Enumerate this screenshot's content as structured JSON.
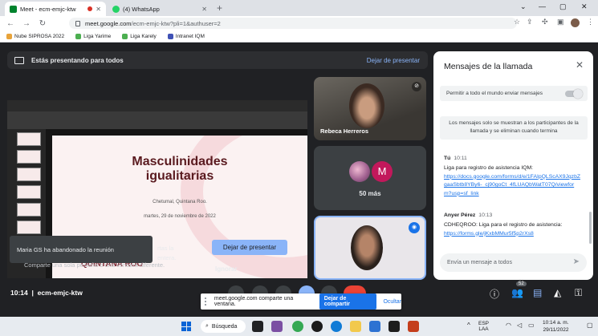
{
  "browser": {
    "tabs": [
      {
        "title": "Meet - ecm-emjc-ktw",
        "active": true
      },
      {
        "title": "(4) WhatsApp",
        "active": false
      }
    ],
    "url_host": "meet.google.com",
    "url_path": "/ecm-emjc-ktw?pli=1&authuser=2",
    "bookmarks": [
      "Nube SIPROSA 2022",
      "Liga Yarime",
      "Liga Karely",
      "Intranet IQM"
    ]
  },
  "meet": {
    "presenting_text": "Estás presentando para todos",
    "stop_presenting_link": "Dejar de presentar",
    "toast": "Maria GS ha abandonado la reunión",
    "warning_line1": "rtas la",
    "warning_line2": "entera.",
    "warning_line3": "Comparte una sola pestaña o una ventana diferente.",
    "stop_presenting_button": "Dejar de presentar",
    "ignore_button": "Ignorar",
    "slide": {
      "title_line1": "Masculinidades",
      "title_line2": "igualitarias",
      "place": "Chetumal, Quintana Roo.",
      "date": "martes, 29 de noviembre de 2022",
      "logo": "QUINTANA ROO"
    },
    "participants": {
      "tile1_name": "Rebeca Herreros",
      "more_count": "50 más",
      "avatar_letter": "M"
    },
    "meeting_time": "10:14",
    "meeting_code": "ecm-emjc-ktw",
    "participants_badge": "52"
  },
  "chat": {
    "title": "Mensajes de la llamada",
    "permission_label": "Permitir a todo el mundo enviar mensajes",
    "notice": "Los mensajes solo se muestran a los participantes de la llamada y se eliminan cuando termina",
    "messages": [
      {
        "sender": "Tú",
        "time": "10:11",
        "text": "Liga para registro de asistencia IQM:",
        "link": "https://docs.google.com/forms/d/e/1FAIpQLScAX9JqzbZgaaSbtb8YBy6-_cj90goCt_4fLUAQbWatT07Q/viewform?usp=sf_link"
      },
      {
        "sender": "Anyer Pérez",
        "time": "10:13",
        "text": "CDHEQROO: Liga para el registro de asistencia:",
        "link": "https://forms.gle/jKxbMMur5f5p2rXs8"
      }
    ],
    "input_placeholder": "Envía un mensaje a todos"
  },
  "sharebar": {
    "message": "meet.google.com comparte una ventana.",
    "stop_button": "Dejar de compartir",
    "hide_button": "Ocultar"
  },
  "taskbar": {
    "search_label": "Búsqueda",
    "lang_line1": "ESP",
    "lang_line2": "LAA",
    "time": "10:14 a. m.",
    "date": "29/11/2022"
  }
}
